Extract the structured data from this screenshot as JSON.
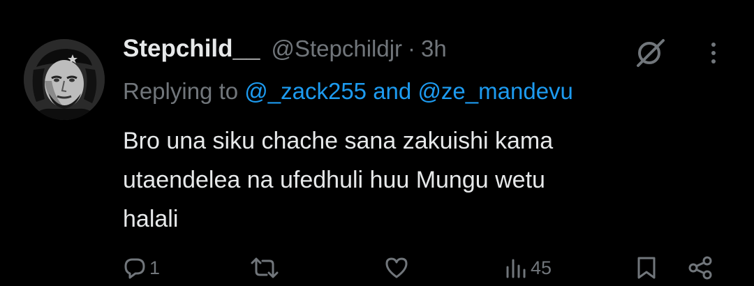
{
  "tweet": {
    "author_name": "Stepchild__",
    "handle": "@Stepchildjr",
    "separator": "·",
    "time": "3h",
    "replying_prefix": "Replying to ",
    "mention_1": "@_zack255",
    "replying_joiner": " and ",
    "mention_2": "@ze_mandevu",
    "line_1": "Bro una siku chache sana zakuishi kama",
    "line_2": "utaendelea na ufedhuli huu Mungu wetu",
    "line_3": "halali"
  },
  "actions": {
    "reply_count": "1",
    "views_count": "45"
  },
  "icons": {
    "avatar": "avatar-portrait",
    "grok": "grok-icon",
    "more": "more-vertical-icon",
    "reply": "reply-icon",
    "retweet": "retweet-icon",
    "like": "heart-icon",
    "views": "views-chart-icon",
    "bookmark": "bookmark-icon",
    "share": "share-icon"
  },
  "colors": {
    "background": "#000000",
    "text": "#e7e9ea",
    "muted": "#71767b",
    "link": "#1d9bf0"
  }
}
